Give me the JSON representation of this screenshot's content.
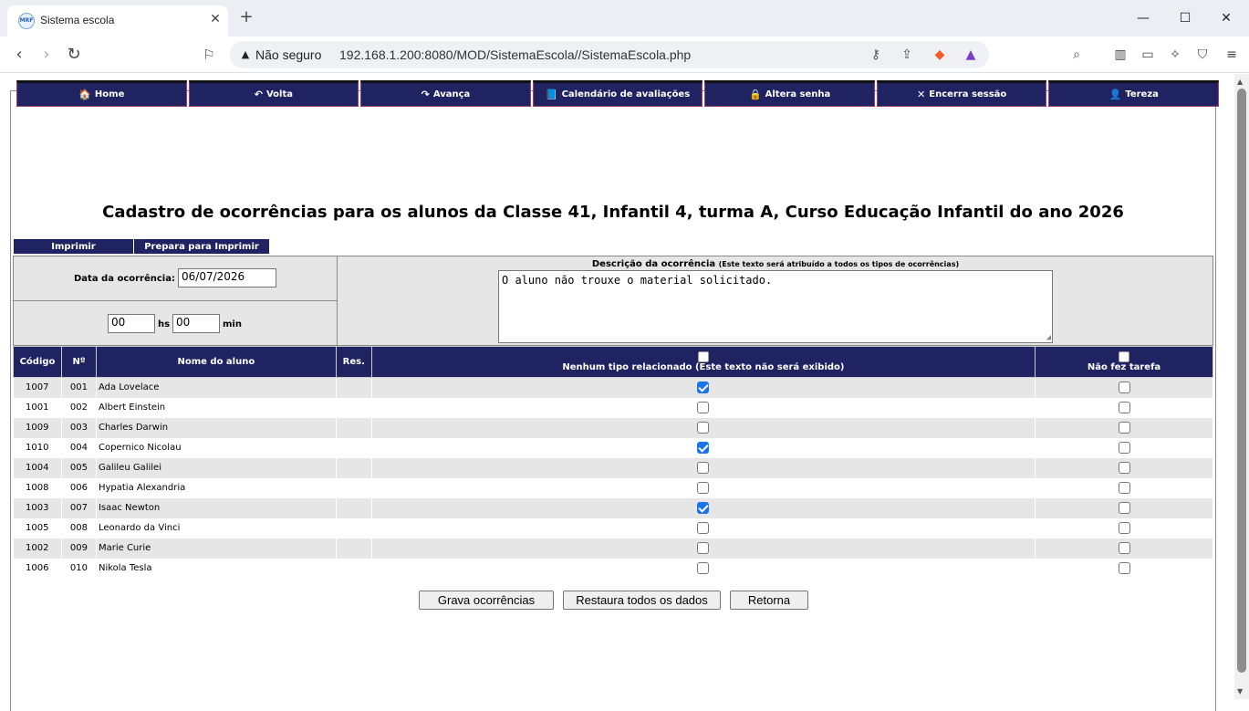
{
  "browser": {
    "tab_title": "Sistema escola",
    "favicon_text": "MRF",
    "url_security": "Não seguro",
    "url": "192.168.1.200:8080/MOD/SistemaEscola//SistemaEscola.php"
  },
  "menu": [
    {
      "icon": "home-icon",
      "glyph": "🏠",
      "label": "Home"
    },
    {
      "icon": "undo-icon",
      "glyph": "↶",
      "label": "Volta"
    },
    {
      "icon": "redo-icon",
      "glyph": "↷",
      "label": "Avança"
    },
    {
      "icon": "calendar-icon",
      "glyph": "📘",
      "label": "Calendário de avaliações"
    },
    {
      "icon": "lock-icon",
      "glyph": "🔒",
      "label": "Altera senha"
    },
    {
      "icon": "close-x-icon",
      "glyph": "✕",
      "label": "Encerra sessão"
    },
    {
      "icon": "user-icon",
      "glyph": "👤",
      "label": "Tereza"
    }
  ],
  "page_title": "Cadastro de ocorrências para os alunos da Classe 41, Infantil 4, turma A, Curso Educação Infantil do ano 2026",
  "print_buttons": {
    "print": "Imprimir",
    "prepare": "Prepara para Imprimir"
  },
  "form": {
    "date_label": "Data da ocorrência:",
    "date_value": "06/07/2026",
    "hours_value": "00",
    "hours_label": "hs",
    "minutes_value": "00",
    "minutes_label": "min",
    "desc_title": "Descrição da ocorrência",
    "desc_note": "(Este texto será atribuído a todos os tipos de ocorrências)",
    "desc_value": "O aluno não trouxe o material solicitado."
  },
  "table": {
    "headers": {
      "code": "Código",
      "number": "Nº",
      "name": "Nome do aluno",
      "res": "Res.",
      "type_none": "Nenhum tipo relacionado (Este texto não será exibido)",
      "no_homework": "Não fez tarefa"
    },
    "rows": [
      {
        "code": "1007",
        "num": "001",
        "name": "Ada Lovelace",
        "type_none": true,
        "no_homework": false
      },
      {
        "code": "1001",
        "num": "002",
        "name": "Albert Einstein",
        "type_none": false,
        "no_homework": false
      },
      {
        "code": "1009",
        "num": "003",
        "name": "Charles Darwin",
        "type_none": false,
        "no_homework": false
      },
      {
        "code": "1010",
        "num": "004",
        "name": "Copernico Nicolau",
        "type_none": true,
        "no_homework": false
      },
      {
        "code": "1004",
        "num": "005",
        "name": "Galileu Galilei",
        "type_none": false,
        "no_homework": false
      },
      {
        "code": "1008",
        "num": "006",
        "name": "Hypatia Alexandria",
        "type_none": false,
        "no_homework": false
      },
      {
        "code": "1003",
        "num": "007",
        "name": "Isaac Newton",
        "type_none": true,
        "no_homework": false
      },
      {
        "code": "1005",
        "num": "008",
        "name": "Leonardo da Vinci",
        "type_none": false,
        "no_homework": false
      },
      {
        "code": "1002",
        "num": "009",
        "name": "Marie Curie",
        "type_none": false,
        "no_homework": false
      },
      {
        "code": "1006",
        "num": "010",
        "name": "Nikola Tesla",
        "type_none": false,
        "no_homework": false
      }
    ]
  },
  "actions": {
    "save": "Grava ocorrências",
    "restore": "Restaura todos os dados",
    "back": "Retorna"
  },
  "colors": {
    "menu_bg": "#1f2361",
    "row_alt": "#e6e6e6",
    "checkbox_checked": "#1a73e8"
  }
}
